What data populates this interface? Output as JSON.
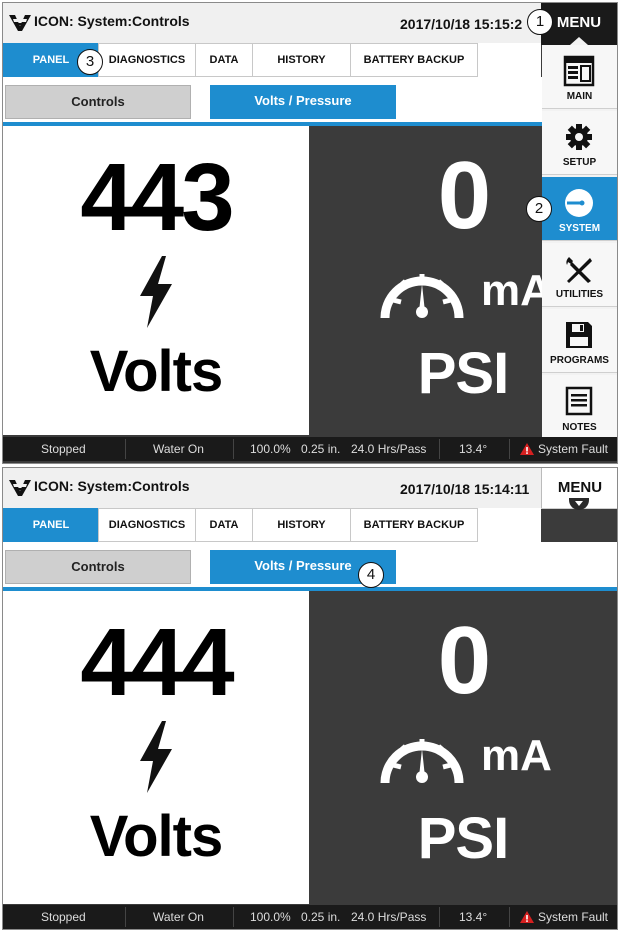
{
  "screenshots": [
    {
      "app_title": "ICON: System:Controls",
      "datetime": "2017/10/18 15:15:2",
      "menu_label": "MENU",
      "subtabs": [
        "PANEL",
        "DIAGNOSTICS",
        "DATA",
        "HISTORY",
        "BATTERY BACKUP"
      ],
      "panel_tabs": [
        "Controls",
        "Volts / Pressure"
      ],
      "volts_value": "443",
      "volts_label": "Volts",
      "current_value": "0",
      "current_unit": "mA",
      "pressure_label": "PSI",
      "side_menu": [
        "MAIN",
        "SETUP",
        "SYSTEM",
        "UTILITIES",
        "PROGRAMS",
        "NOTES"
      ],
      "callouts": [
        "1",
        "2",
        "3"
      ]
    },
    {
      "app_title": "ICON: System:Controls",
      "datetime": "2017/10/18 15:14:11",
      "menu_label": "MENU",
      "subtabs": [
        "PANEL",
        "DIAGNOSTICS",
        "DATA",
        "HISTORY",
        "BATTERY BACKUP"
      ],
      "panel_tabs": [
        "Controls",
        "Volts / Pressure"
      ],
      "volts_value": "444",
      "volts_label": "Volts",
      "current_value": "0",
      "current_unit": "mA",
      "pressure_label": "PSI",
      "callouts": [
        "4"
      ]
    }
  ],
  "status_bar": {
    "state": "Stopped",
    "water": "Water On",
    "percent": "100.0%",
    "depth": "0.25 in.",
    "hours_per_pass": "24.0 Hrs/Pass",
    "angle": "13.4°",
    "fault": "System Fault"
  },
  "icons": {
    "logo": "brand-logo-icon",
    "volts": "lightning-bolt-icon",
    "pressure": "gauge-icon",
    "fault": "warning-triangle-icon"
  },
  "colors": {
    "accent": "#1e8dcf",
    "dark": "#3b3b3b",
    "fault": "#d62020"
  }
}
